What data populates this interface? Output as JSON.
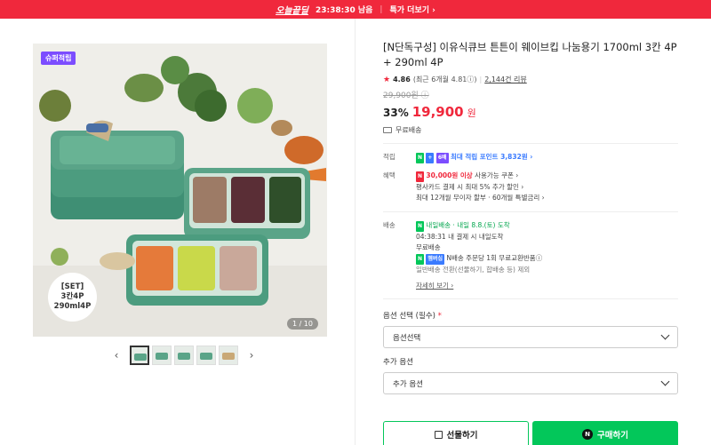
{
  "topbar": {
    "brand": "오늘끝딜",
    "timer": "23:38:30 남음",
    "more": "특가 더보기 ›"
  },
  "gallery": {
    "badge": "슈퍼적립",
    "set_line1": "[SET]",
    "set_line2": "3칸4P",
    "set_line3": "290ml4P",
    "page": "1 / 10",
    "thumb_count": 5,
    "prev": "‹",
    "next": "›"
  },
  "product": {
    "title": "[N단독구성] 이유식큐브 튼튼이 웨이브킵 나눔용기 1700ml 3칸 4P + 290ml 4P",
    "rating": "4.86",
    "rating_recent": "(최근 6개월 4.81ⓘ)",
    "reviews": "2,144건 리뷰",
    "original_price": "29,900원 ⓘ",
    "discount": "33%",
    "price": "19,900",
    "won": "원",
    "shipping": "무료배송"
  },
  "benefits": {
    "point_label": "적립",
    "point_badge_n": "N",
    "point_badge_plus": "+",
    "point_badge_x": "6배",
    "point_text": "최대 적립 포인트 3,832원 ›",
    "benefit_label": "혜택",
    "benefit_badge": "N",
    "benefit_amount": "30,000원 이상",
    "benefit_line1": " 사용가능 쿠폰 ›",
    "benefit_line2": "평사카드 결제 시 최대 5% 추가 할인 ›",
    "benefit_line3": "최대 12개월 무이자 할부 · 60개월 특별금리 ›"
  },
  "delivery": {
    "label": "배송",
    "arrival_badge": "N",
    "arrival_type": "내일배송",
    "arrival_text": "· 내일 8.8.(토) 도착",
    "cutoff": "04:38:31 내 결제 시 내일도착",
    "free": "무료배송",
    "return_badge": "N",
    "return_badge2": "멤버십",
    "return_text": "N배송 주문당 1회 무료교환반품ⓘ",
    "return_sub": "일반배송 전환(선물하기, 합배송 등) 제외",
    "detail": "자세히 보기 ›"
  },
  "options": {
    "required_label": "옵션 선택 (필수)",
    "required_mark": "*",
    "required_value": "옵션선택",
    "extra_label": "추가 옵션",
    "extra_value": "추가 옵션"
  },
  "actions": {
    "gift": "선물하기",
    "buy": "구매하기",
    "buy_icon": "N"
  },
  "colors": {
    "accent_red": "#f0283c",
    "naver_green": "#03c75a",
    "container_green": "#5aa488"
  }
}
